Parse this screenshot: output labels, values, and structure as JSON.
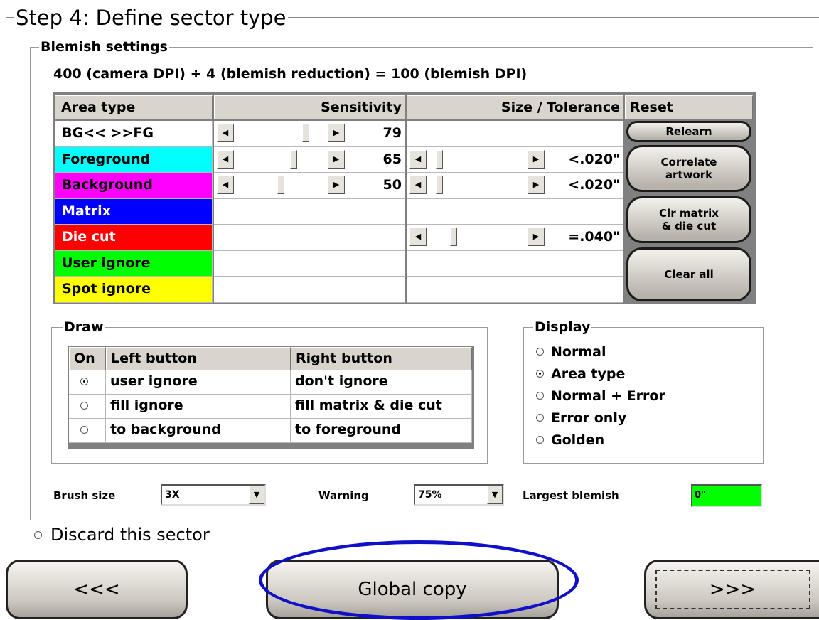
{
  "step_title": "Step 4: Define sector type",
  "blemish": {
    "legend": "Blemish settings",
    "formula": "400 (camera DPI) ÷ 4 (blemish reduction) = 100 (blemish DPI)"
  },
  "table": {
    "headers": {
      "area_type": "Area type",
      "sensitivity": "Sensitivity",
      "size_tolerance": "Size / Tolerance",
      "reset": "Reset"
    },
    "rows": [
      {
        "label": "BG<< >>FG",
        "color": "#ffffff",
        "text_color": "#000000",
        "sensitivity": "79",
        "sensitivity_level": 0.79,
        "size": "",
        "size_level": null
      },
      {
        "label": "Foreground",
        "color": "#00ffff",
        "text_color": "#000000",
        "sensitivity": "65",
        "sensitivity_level": 0.65,
        "size": "<.020\"",
        "size_level": 0.1
      },
      {
        "label": "Background",
        "color": "#ff00ff",
        "text_color": "#000000",
        "sensitivity": "50",
        "sensitivity_level": 0.5,
        "size": "<.020\"",
        "size_level": 0.1
      },
      {
        "label": "Matrix",
        "color": "#0000ff",
        "text_color": "#ffffff",
        "sensitivity": "",
        "sensitivity_level": null,
        "size": "",
        "size_level": null
      },
      {
        "label": "Die cut",
        "color": "#ff0000",
        "text_color": "#ffffff",
        "sensitivity": "",
        "sensitivity_level": null,
        "size": "=.040\"",
        "size_level": 0.25
      },
      {
        "label": "User ignore",
        "color": "#00ff00",
        "text_color": "#000000",
        "sensitivity": "",
        "sensitivity_level": null,
        "size": "",
        "size_level": null
      },
      {
        "label": "Spot ignore",
        "color": "#ffff00",
        "text_color": "#000000",
        "sensitivity": "",
        "sensitivity_level": null,
        "size": "",
        "size_level": null
      }
    ],
    "reset_buttons": {
      "relearn": "Relearn",
      "correlate": "Correlate\nartwork",
      "clr_matrix": "Clr matrix\n& die cut",
      "clear_all": "Clear all"
    }
  },
  "draw": {
    "legend": "Draw",
    "headers": {
      "on": "On",
      "left": "Left button",
      "right": "Right button"
    },
    "rows": [
      {
        "selected": true,
        "left": "user ignore",
        "right": "don't ignore"
      },
      {
        "selected": false,
        "left": "fill ignore",
        "right": "fill matrix & die cut"
      },
      {
        "selected": false,
        "left": "to background",
        "right": "to foreground"
      }
    ]
  },
  "display": {
    "legend": "Display",
    "options": [
      {
        "label": "Normal",
        "selected": false
      },
      {
        "label": "Area type",
        "selected": true
      },
      {
        "label": "Normal + Error",
        "selected": false
      },
      {
        "label": "Error only",
        "selected": false
      },
      {
        "label": "Golden",
        "selected": false
      }
    ]
  },
  "bottom": {
    "brush_label": "Brush size",
    "brush_value": "3X",
    "warning_label": "Warning",
    "warning_value": "75%",
    "largest_label": "Largest blemish",
    "largest_value": "0\"",
    "largest_color": "#00ff00"
  },
  "discard_label": "Discard this sector",
  "nav": {
    "prev": "<<<",
    "global": "Global copy",
    "next": ">>>"
  },
  "highlight_color": "#1010c8"
}
